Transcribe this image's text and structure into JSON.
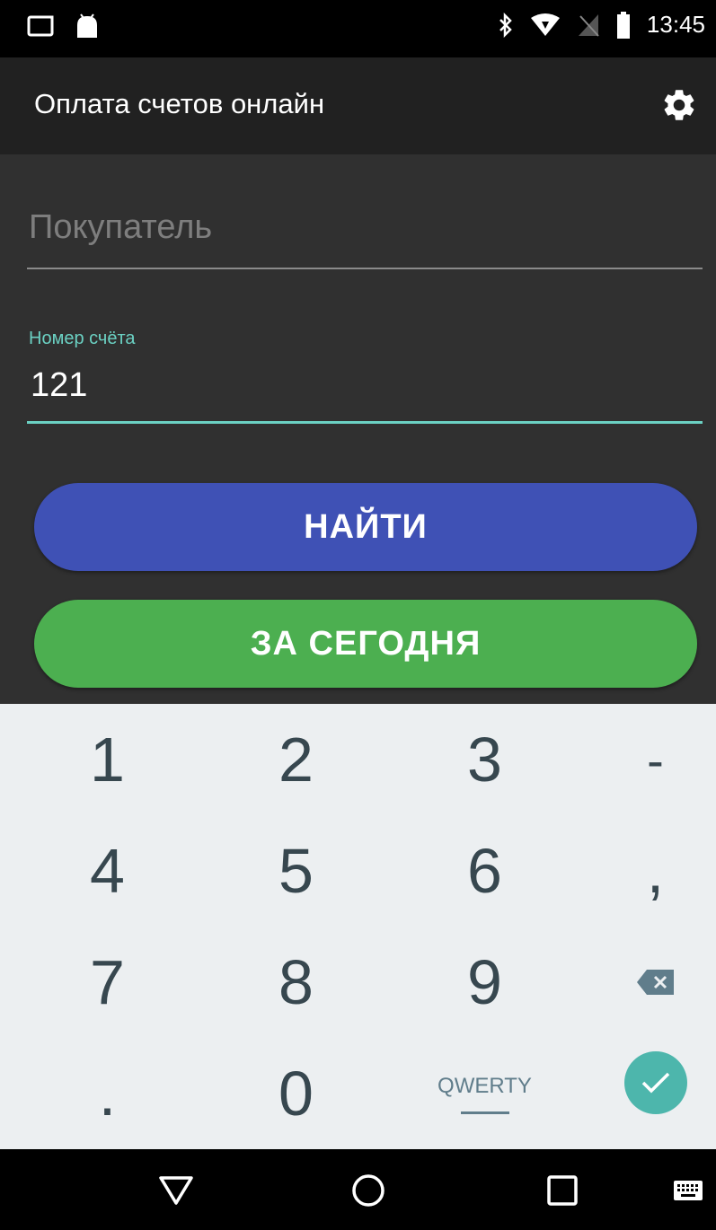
{
  "status_bar": {
    "time": "13:45",
    "left_icons": [
      "screenshot-icon",
      "android-icon"
    ],
    "right_icons": [
      "bluetooth-icon",
      "wifi-icon",
      "no-sim-icon",
      "battery-icon"
    ]
  },
  "app_bar": {
    "title": "Оплата счетов онлайн",
    "settings_icon": "gear-icon"
  },
  "form": {
    "buyer": {
      "placeholder": "Покупатель",
      "value": ""
    },
    "invoice": {
      "label": "Номер счёта",
      "value": "121"
    },
    "find_button": "НАЙТИ",
    "today_button": "ЗА СЕГОДНЯ"
  },
  "colors": {
    "accent": "#6bd1c3",
    "find_button": "#3f51b5",
    "today_button": "#4caf50",
    "keyboard_bg": "#eceff1"
  },
  "keyboard": {
    "rows": [
      [
        "1",
        "2",
        "3",
        "-"
      ],
      [
        "4",
        "5",
        "6",
        ","
      ],
      [
        "7",
        "8",
        "9",
        "⌫"
      ],
      [
        ".",
        "0",
        "QWERTY",
        "✓"
      ]
    ],
    "backspace_icon": "backspace-icon",
    "done_icon": "check-icon"
  },
  "nav_bar": {
    "buttons": [
      "back-icon",
      "home-icon",
      "recents-icon",
      "keyboard-icon"
    ]
  }
}
